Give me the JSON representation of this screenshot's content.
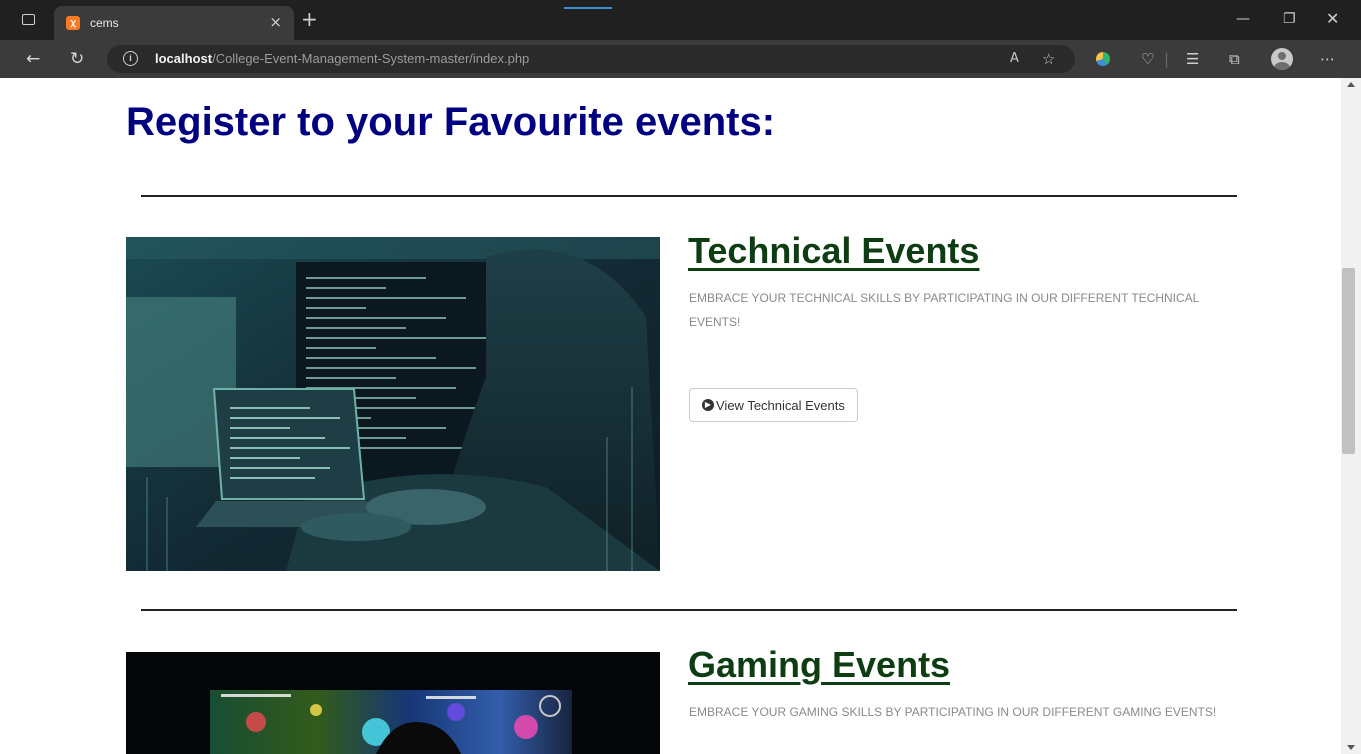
{
  "browser": {
    "tab_title": "cems",
    "tab_close": "×",
    "new_tab": "+",
    "url_host": "localhost",
    "url_path": "/College-Event-Management-System-master/index.php",
    "icons": [
      "window-icon",
      "xampp-favicon",
      "back-icon",
      "reload-icon",
      "info-icon",
      "read-aloud-icon",
      "favorite-add-icon",
      "extension-icon",
      "browser-essentials-icon",
      "favorites-icon",
      "collections-icon",
      "profile-icon",
      "more-icon"
    ]
  },
  "page": {
    "title": "Register to your Favourite events:",
    "events": [
      {
        "heading": "Technical Events",
        "description": "EMBRACE YOUR TECHNICAL SKILLS BY PARTICIPATING IN OUR DIFFERENT TECHNICAL EVENTS!",
        "button_label": "View Technical Events"
      },
      {
        "heading": "Gaming Events",
        "description": "EMBRACE YOUR GAMING SKILLS BY PARTICIPATING IN OUR DIFFERENT GAMING EVENTS!"
      }
    ]
  },
  "colors": {
    "title": "#000080",
    "heading": "#0f3d13",
    "description": "#8a8a8a"
  }
}
